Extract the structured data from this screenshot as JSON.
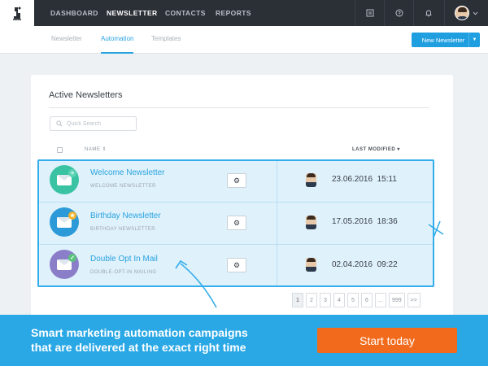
{
  "topbar": {
    "nav": [
      "DASHBOARD",
      "NEWSLETTER",
      "CONTACTS",
      "REPORTS"
    ],
    "active_index": 1,
    "icons": [
      "grid-icon",
      "help-icon",
      "bell-icon"
    ]
  },
  "subnav": {
    "tabs": [
      "Newsletter",
      "Automation",
      "Templates"
    ],
    "active_index": 1,
    "new_button_label": "New Newsletter"
  },
  "card": {
    "title": "Active Newsletters",
    "search_placeholder": "Quick Search",
    "col_name": "NAME",
    "col_modified": "LAST MODIFIED"
  },
  "rows": [
    {
      "title": "Welcome Newsletter",
      "subtitle": "WELCOME NEWSLETTER",
      "date": "23.06.2016",
      "time": "15:11",
      "icon_color": "#39c3a2",
      "badge_color": "#5fd3b5",
      "badge": "+"
    },
    {
      "title": "Birthday Newsletter",
      "subtitle": "BIRTHDAY NEWSLETTER",
      "date": "17.05.2016",
      "time": "18:36",
      "icon_color": "#2c9ad8",
      "badge_color": "#f6b42a",
      "badge": "★"
    },
    {
      "title": "Double Opt In Mail",
      "subtitle": "DOUBLE-OPT-IN MAILING",
      "date": "02.04.2016",
      "time": "09:22",
      "icon_color": "#8b7ec9",
      "badge_color": "#5ac37b",
      "badge": "✓"
    }
  ],
  "pagination": {
    "pages": [
      "1",
      "2",
      "3",
      "4",
      "5",
      "6",
      "...",
      "999",
      ">>"
    ],
    "active_index": 0
  },
  "banner": {
    "line1": "Smart marketing automation campaigns",
    "line2": "that are delivered at the exact right time",
    "cta_label": "Start today"
  }
}
